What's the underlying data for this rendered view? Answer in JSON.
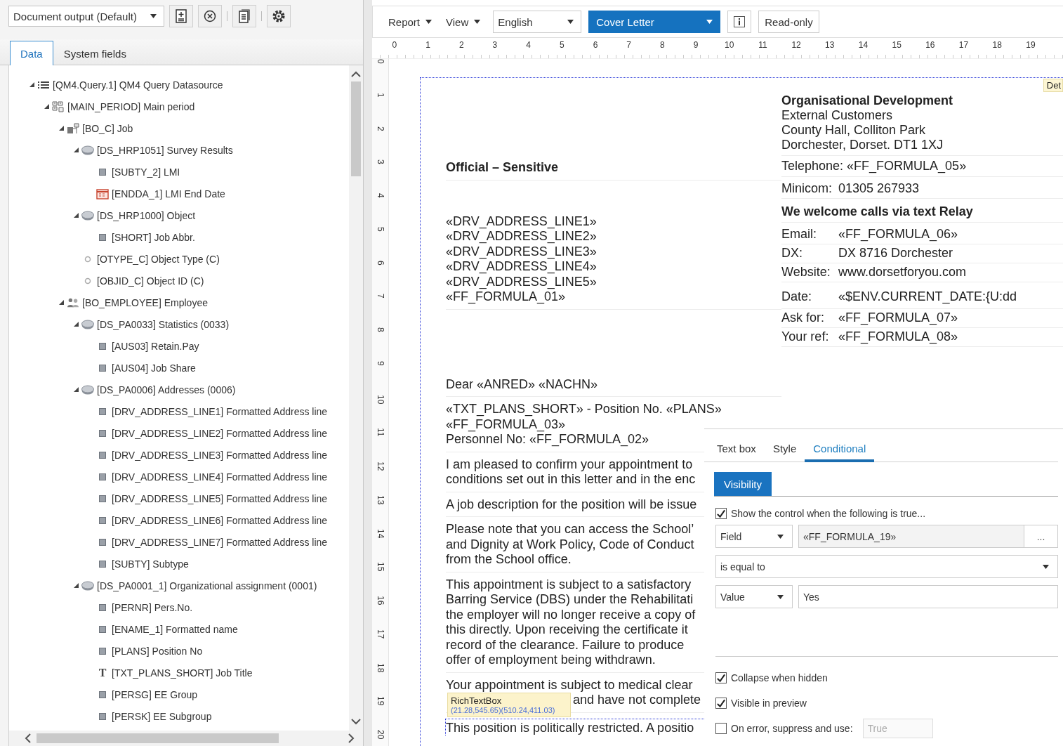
{
  "left_panel": {
    "output_select": "Document output (Default)",
    "toolbar_buttons": [
      {
        "kind": "add_document"
      },
      {
        "kind": "cancel"
      },
      {
        "kind": "document"
      },
      {
        "kind": "settings"
      }
    ],
    "tabs": [
      {
        "label": "Data",
        "selected": true
      },
      {
        "label": "System fields",
        "selected": false
      }
    ],
    "tree": [
      {
        "label": "[QM4.Query.1] QM4 Query Datasource",
        "kind": "datasource",
        "expanded": true,
        "children": [
          {
            "label": "[MAIN_PERIOD] Main period",
            "kind": "period",
            "expanded": true,
            "children": [
              {
                "label": "[BO_C] Job",
                "kind": "object",
                "expanded": true,
                "children": [
                  {
                    "label": "[DS_HRP1051] Survey Results",
                    "kind": "table",
                    "expanded": true,
                    "children": [
                      {
                        "label": "[SUBTY_2] LMI",
                        "kind": "field"
                      },
                      {
                        "label": "[ENDDA_1] LMI End Date",
                        "kind": "date"
                      }
                    ]
                  },
                  {
                    "label": "[DS_HRP1000] Object",
                    "kind": "table",
                    "expanded": true,
                    "children": [
                      {
                        "label": "[SHORT] Job Abbr.",
                        "kind": "field"
                      }
                    ]
                  },
                  {
                    "label": "[OTYPE_C] Object Type (C)",
                    "kind": "key"
                  },
                  {
                    "label": "[OBJID_C] Object ID (C)",
                    "kind": "key"
                  }
                ]
              },
              {
                "label": "[BO_EMPLOYEE] Employee",
                "kind": "person",
                "expanded": true,
                "children": [
                  {
                    "label": "[DS_PA0033] Statistics (0033)",
                    "kind": "table",
                    "expanded": true,
                    "children": [
                      {
                        "label": "[AUS03] Retain.Pay",
                        "kind": "field"
                      },
                      {
                        "label": "[AUS04] Job Share",
                        "kind": "field"
                      }
                    ]
                  },
                  {
                    "label": "[DS_PA0006] Addresses (0006)",
                    "kind": "table",
                    "expanded": true,
                    "children": [
                      {
                        "label": "[DRV_ADDRESS_LINE1] Formatted Address line",
                        "kind": "field"
                      },
                      {
                        "label": "[DRV_ADDRESS_LINE2] Formatted Address line",
                        "kind": "field"
                      },
                      {
                        "label": "[DRV_ADDRESS_LINE3] Formatted Address line",
                        "kind": "field"
                      },
                      {
                        "label": "[DRV_ADDRESS_LINE4] Formatted Address line",
                        "kind": "field"
                      },
                      {
                        "label": "[DRV_ADDRESS_LINE5] Formatted Address line",
                        "kind": "field"
                      },
                      {
                        "label": "[DRV_ADDRESS_LINE6] Formatted Address line",
                        "kind": "field"
                      },
                      {
                        "label": "[DRV_ADDRESS_LINE7] Formatted Address line",
                        "kind": "field"
                      },
                      {
                        "label": "[SUBTY] Subtype",
                        "kind": "field"
                      }
                    ]
                  },
                  {
                    "label": "[DS_PA0001_1] Organizational assignment (0001)",
                    "kind": "table",
                    "expanded": true,
                    "children": [
                      {
                        "label": "[PERNR] Pers.No.",
                        "kind": "field"
                      },
                      {
                        "label": "[ENAME_1] Formatted name",
                        "kind": "field"
                      },
                      {
                        "label": "[PLANS] Position No",
                        "kind": "field"
                      },
                      {
                        "label": "[TXT_PLANS_SHORT] Job Title",
                        "kind": "text",
                        "glyph": "T"
                      },
                      {
                        "label": "[PERSG] EE Group",
                        "kind": "field"
                      },
                      {
                        "label": "[PERSK] EE Subgroup",
                        "kind": "field"
                      }
                    ]
                  }
                ]
              }
            ]
          }
        ]
      }
    ]
  },
  "designer": {
    "toolbar": {
      "menus": [
        "Report",
        "View"
      ],
      "language": "English",
      "template": "Cover Letter",
      "read_only_button": "Read-only"
    },
    "ruler": {
      "horizontal": [
        "0",
        "1",
        "2",
        "3",
        "4",
        "5",
        "6",
        "7",
        "8",
        "9",
        "10",
        "11",
        "12",
        "13",
        "14",
        "15",
        "16",
        "17",
        "18",
        "19"
      ],
      "vertical": [
        "0",
        "1",
        "2",
        "3",
        "4",
        "5",
        "6",
        "7",
        "8",
        "9",
        "10",
        "11",
        "12",
        "13",
        "14",
        "15",
        "16",
        "17",
        "18",
        "19",
        "20"
      ]
    },
    "section_label": "Det",
    "letter": {
      "header": [
        {
          "kind": "line",
          "text": "Organisational Development",
          "bold": true
        },
        {
          "kind": "line",
          "text": "External Customers",
          "bold": false
        },
        {
          "kind": "line",
          "text": "County Hall, Colliton Park",
          "bold": false
        },
        {
          "kind": "line",
          "text": "Dorchester, Dorset.  DT1 1XJ",
          "bold": false
        },
        {
          "kind": "line",
          "text": "Telephone: «FF_FORMULA_05»",
          "bold": false
        },
        {
          "kind": "pair",
          "label": "Minicom:",
          "value": "01305 267933"
        },
        {
          "kind": "line",
          "text": "We welcome calls via text Relay",
          "bold": true
        },
        {
          "kind": "pair",
          "label": "Email:",
          "value": "«FF_FORMULA_06»"
        },
        {
          "kind": "pair",
          "label": "DX:",
          "value": "DX 8716 Dorchester"
        },
        {
          "kind": "pair",
          "label": "Website:",
          "value": "www.dorsetforyou.com"
        },
        {
          "kind": "pair",
          "label": "Date:",
          "value": "«$ENV.CURRENT_DATE:{U:dd"
        },
        {
          "kind": "pair",
          "label": "Ask for:",
          "value": "«FF_FORMULA_07»"
        },
        {
          "kind": "pair",
          "label": "Your ref:",
          "value": "«FF_FORMULA_08»"
        }
      ],
      "blocks": [
        {
          "kind": "heading",
          "lines": [
            "Official – Sensitive"
          ]
        },
        {
          "kind": "address",
          "lines": [
            "«DRV_ADDRESS_LINE1»",
            "«DRV_ADDRESS_LINE2»",
            "«DRV_ADDRESS_LINE3»",
            "«DRV_ADDRESS_LINE4»",
            "«DRV_ADDRESS_LINE5»",
            "«FF_FORMULA_01»"
          ]
        },
        {
          "kind": "salutation",
          "lines": [
            "Dear «ANRED» «NACHN»"
          ]
        },
        {
          "kind": "paragraph",
          "lines": [
            "«TXT_PLANS_SHORT» - Position No. «PLANS»",
            "«FF_FORMULA_03»",
            "Personnel No: «FF_FORMULA_02»"
          ]
        },
        {
          "kind": "paragraph",
          "lines": [
            "I am pleased to confirm your appointment to",
            "conditions set out in this letter and in the enc"
          ]
        },
        {
          "kind": "paragraph",
          "lines": [
            "A job description for the position will be issue"
          ]
        },
        {
          "kind": "paragraph",
          "lines": [
            "Please note that you can access the School’",
            "and Dignity at Work Policy, Code of Conduct",
            "from the School office."
          ]
        },
        {
          "kind": "paragraph",
          "lines": [
            "This appointment is subject to a satisfactory",
            "Barring Service (DBS) under the Rehabilitati",
            "the employer will no longer receive a copy of",
            "this directly.  Upon receiving the certificate it",
            "record of the clearance.  Failure to produce",
            "offer of employment being withdrawn."
          ]
        },
        {
          "kind": "covered",
          "lines": [
            "Your appointment is subject to medical clear",
            "and have not complete"
          ]
        }
      ],
      "footer_line": "This position is politically restricted. A positio",
      "tooltip": {
        "title": "RichTextBox",
        "bounds": "(21.28,545.65)(510.24,411.03)"
      }
    },
    "properties": {
      "tabs": [
        {
          "label": "Text box",
          "selected": false
        },
        {
          "label": "Style",
          "selected": false
        },
        {
          "label": "Conditional",
          "selected": true
        }
      ],
      "subtabs": [
        {
          "label": "Visibility",
          "selected": true
        }
      ],
      "show_condition": {
        "label": "Show the control when the following is true...",
        "checked": true
      },
      "source_type": "Field",
      "source_field": "«FF_FORMULA_19»",
      "browse_button": "...",
      "operator": "is equal to",
      "compare_type": "Value",
      "compare_value": "Yes",
      "options": [
        {
          "label": "Collapse when hidden",
          "checked": true
        },
        {
          "label": "Visible in preview",
          "checked": true
        },
        {
          "label": "On error, suppress and use:",
          "checked": false
        }
      ],
      "error_value": {
        "value": "True",
        "disabled": true
      }
    }
  }
}
